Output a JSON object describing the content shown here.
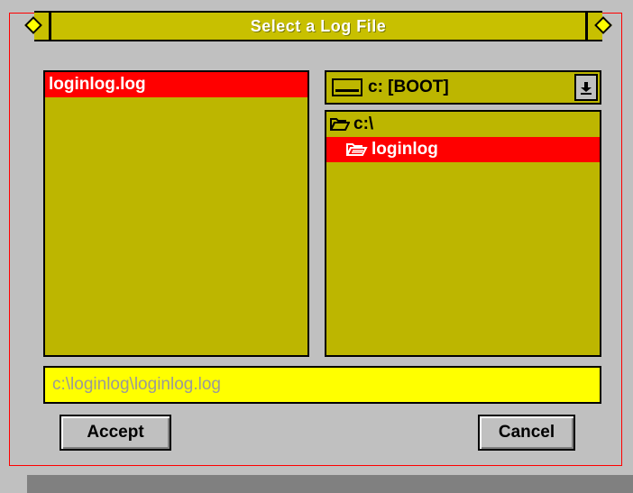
{
  "dialog": {
    "title": "Select a Log File"
  },
  "file_list": {
    "items": [
      {
        "label": "loginlog.log",
        "selected": true
      }
    ]
  },
  "drive_select": {
    "value": "c: [BOOT]",
    "icon": "drive-icon",
    "arrow_icon": "down-arrow-icon"
  },
  "dir_list": {
    "items": [
      {
        "label": "c:\\",
        "icon": "open-folder-icon",
        "selected": false
      },
      {
        "label": "loginlog",
        "icon": "open-folder-icon",
        "selected": true
      }
    ]
  },
  "path_field": {
    "value": "c:\\loginlog\\loginlog.log"
  },
  "buttons": {
    "accept": "Accept",
    "cancel": "Cancel"
  },
  "colors": {
    "panel": "#bdb600",
    "selection": "#ff0000",
    "path_field": "#ffff00",
    "frame_border": "#ff0000"
  }
}
